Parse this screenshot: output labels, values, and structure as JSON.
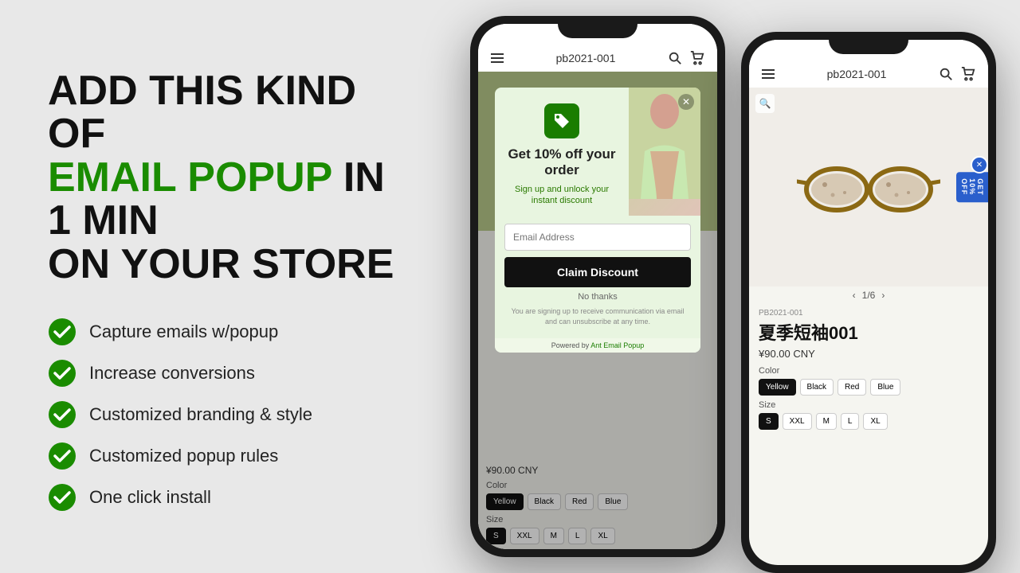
{
  "left": {
    "headline_line1": "ADD THIS KIND OF",
    "headline_line2_green": "EMAIL POPUP",
    "headline_line2_rest": " IN 1 MIN",
    "headline_line3": "ON YOUR STORE",
    "features": [
      "Capture emails w/popup",
      "Increase conversions",
      "Customized branding & style",
      "Customized popup rules",
      "One click install"
    ]
  },
  "phone1": {
    "store_id": "pb2021-001",
    "popup": {
      "tag_icon": "🏷️",
      "title": "Get 10% off your order",
      "subtitle": "Sign up and unlock your instant discount",
      "email_placeholder": "Email Address",
      "btn_label": "Claim Discount",
      "no_thanks": "No thanks",
      "legal": "You are signing up to receive communication via email and can unsubscribe at any time.",
      "powered_by": "Powered by",
      "powered_link": "Ant Email Popup"
    },
    "product": {
      "price": "¥90.00 CNY",
      "color_label": "Color",
      "colors": [
        "Yellow",
        "Black",
        "Red",
        "Blue"
      ],
      "active_color": "Yellow",
      "size_label": "Size",
      "sizes": [
        "S",
        "XXL",
        "M",
        "L",
        "XL"
      ],
      "active_size": "S"
    }
  },
  "phone2": {
    "store_id": "pb2021-001",
    "side_tab": "GET 10% OFF",
    "product": {
      "sku": "PB2021-001",
      "title": "夏季短袖001",
      "price": "¥90.00 CNY",
      "nav": "1/6",
      "color_label": "Color",
      "colors": [
        "Yellow",
        "Black",
        "Red",
        "Blue"
      ],
      "active_color": "Yellow",
      "size_label": "Size",
      "sizes": [
        "S",
        "XXL",
        "M",
        "L",
        "XL"
      ],
      "active_size": "S"
    }
  },
  "colors": {
    "green": "#1a8c00",
    "dark": "#111111",
    "blue_tab": "#2a5fcc"
  }
}
